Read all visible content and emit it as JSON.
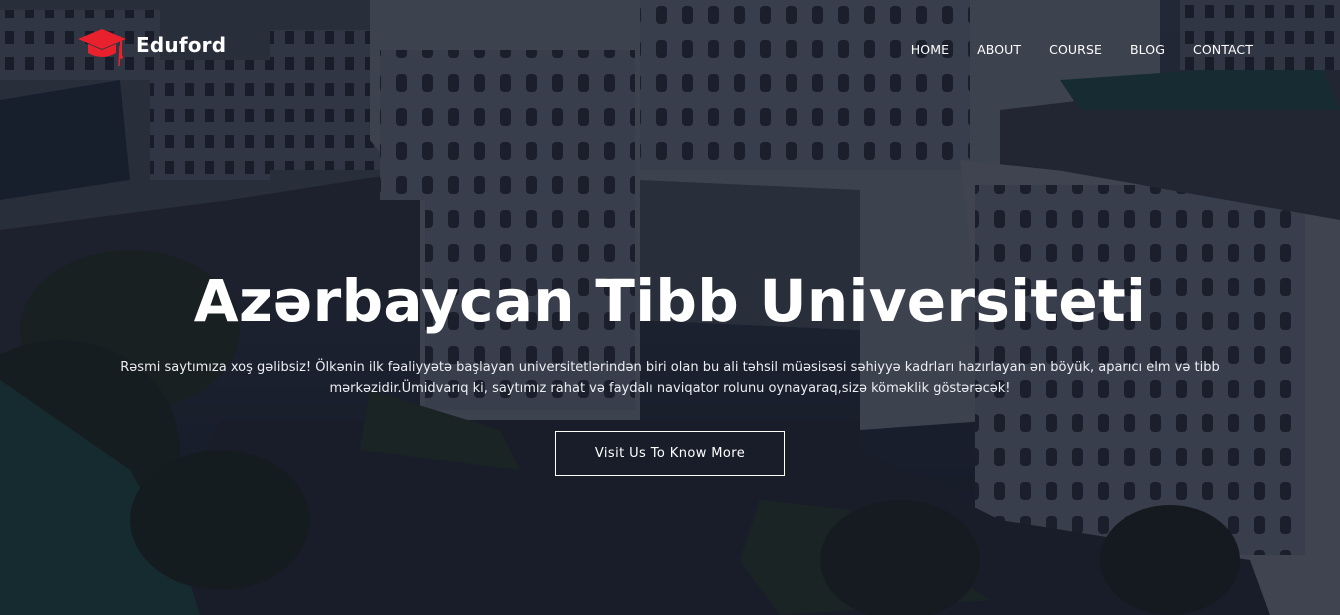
{
  "brand": {
    "name": "Eduford",
    "logo_icon": "graduation-cap-icon",
    "accent_color": "#e8212d"
  },
  "nav": {
    "items": [
      "HOME",
      "ABOUT",
      "COURSE",
      "BLOG",
      "CONTACT"
    ]
  },
  "hero": {
    "title": "Azərbaycan Tibb Universiteti",
    "description": "Rəsmi saytımıza xoş gəlibsiz! Ölkənin ilk fəaliyyətə başlayan universitetlərindən biri olan bu ali təhsil müəsisəsi səhiyyə kadrları hazırlayan ən böyük, aparıcı elm və tibb mərkəzidir.Ümidvarıq ki, saytımız rahat və faydalı naviqator rolunu oynayaraq,sizə köməklik göstərəcək!",
    "cta_label": "Visit Us To Know More",
    "background": "aerial-photo-university-campus"
  }
}
